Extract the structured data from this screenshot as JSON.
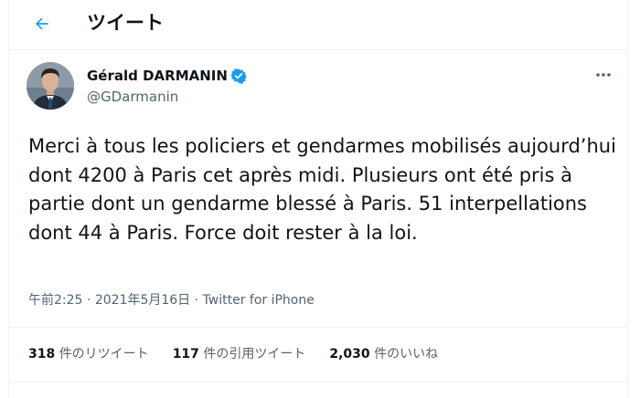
{
  "header": {
    "title": "ツイート",
    "back_icon": "arrow-left-icon"
  },
  "author": {
    "name": "Gérald DARMANIN",
    "handle": "@GDarmanin",
    "verified": true
  },
  "tweet": {
    "text": "Merci à tous les policiers et gendarmes mobilisés aujourd’hui dont 4200 à Paris cet après midi. Plusieurs ont été pris à partie dont un gendarme blessé à Paris. 51 interpellations dont 44 à Paris. Force doit rester à la loi.",
    "time": "午前2:25",
    "date": "2021年5月16日",
    "separator": "·",
    "source": "Twitter for iPhone"
  },
  "stats": [
    {
      "count": "318",
      "label": "件のリツイート"
    },
    {
      "count": "117",
      "label": "件の引用ツイート"
    },
    {
      "count": "2,030",
      "label": "件のいいね"
    }
  ],
  "colors": {
    "accent": "#1d9bf0",
    "secondary_text": "#536471",
    "border": "#eff3f4"
  }
}
